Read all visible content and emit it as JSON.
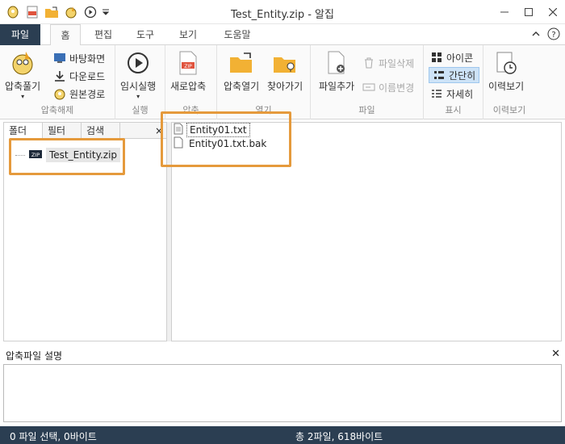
{
  "window": {
    "title": "Test_Entity.zip - 알집"
  },
  "tabs": {
    "file": "파일",
    "home": "홈",
    "edit": "편집",
    "tools": "도구",
    "view": "보기",
    "help": "도움말"
  },
  "ribbon": {
    "extract": {
      "label": "압축풀기",
      "desktop": "바탕화면",
      "download": "다운로드",
      "original": "원본경로",
      "group": "압축해제"
    },
    "run": {
      "label": "임시실행",
      "group": "실행"
    },
    "compress": {
      "new": "새로압축",
      "group": "압축"
    },
    "open": {
      "open_zip": "압축열기",
      "find": "찾아가기",
      "group": "열기"
    },
    "file": {
      "add": "파일추가",
      "delete": "파일삭제",
      "rename": "이름변경",
      "group": "파일"
    },
    "display": {
      "icon": "아이콘",
      "simple": "간단히",
      "detail": "자세히",
      "group": "표시"
    },
    "history": {
      "view": "이력보기",
      "group": "이력보기"
    }
  },
  "left_panel": {
    "tabs": [
      "폴더",
      "필터",
      "검색"
    ],
    "close": "×",
    "tree_item": "Test_Entity.zip",
    "zip_badge": "ZIP"
  },
  "files": [
    "Entity01.txt",
    "Entity01.txt.bak"
  ],
  "description": {
    "title": "압축파일 설명",
    "close": "✕"
  },
  "status": {
    "left": "0 파일 선택,  0바이트",
    "right": "총 2파일,  618바이트"
  },
  "colors": {
    "accent_dark": "#2b3e52",
    "highlight": "#e59a3c",
    "selected": "#cde3f7"
  }
}
